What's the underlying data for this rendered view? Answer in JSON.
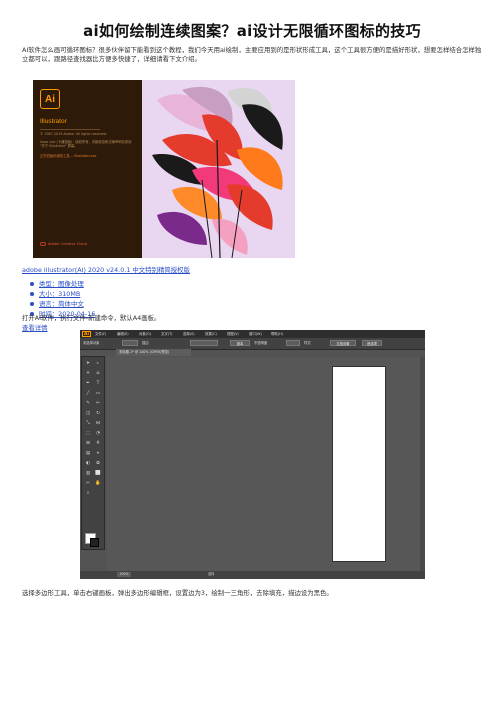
{
  "page": {
    "title": "ai如何绘制连续图案？ai设计无限循环图标的技巧",
    "intro": "AI软件怎么画可循环图标？很多伙伴留下能看到这个教程，我们今天用ai绘制，主要应用到的是形状形成工具，这个工具很方便的是描好形状，想要怎样结合怎样独立都可以，跟路径查找器比方便多快捷了，详细请看下文介绍。"
  },
  "splash": {
    "app_name": "Illustrator",
    "logo_text": "Ai",
    "copyright": "© 1987-2019 Adobe. All rights reserved.",
    "credits": "Isaac Lee (卡通插画) · 版权所有，详细信息和法律声明请参阅 \"关于 Illustrator\" 屏幕。",
    "loading": "正在初始化增效工具... Illustrator.exe",
    "cc_label": "Adobe Creative Cloud",
    "colors": {
      "bg": "#2d1a09",
      "accent": "#ff9a00",
      "art_bg": "#e9d6f0"
    }
  },
  "software": {
    "link": "adobe illustrator(AI) 2020 v24.0.1 中文特别精简授权版",
    "meta": [
      "类型：图像处理",
      "大小：310MB",
      "语言：简体中文",
      "时间：2020-04-16"
    ],
    "details_link": "查看详情"
  },
  "steps": [
    "打开AI软件，执行文件-新建命令，默认A4画板。",
    "选择多边形工具，单击右键画板，弹出多边形编辑框，设置边为3，绘制一三角形，去除填充，描边设为黑色。"
  ],
  "workspace": {
    "logo": "Ai",
    "menus": [
      "文件(F)",
      "编辑(E)",
      "对象(O)",
      "文字(T)",
      "选择(S)",
      "效果(C)",
      "视图(V)",
      "窗口(W)",
      "帮助(H)"
    ],
    "control": [
      "未选择对象",
      "描边",
      "基本",
      "不透明度",
      "样式",
      "文档设置",
      "首选项"
    ],
    "doc_tab": "未标题-1* @ 100% (CMYK/预览)",
    "zoom": "100%",
    "status": "选择"
  }
}
